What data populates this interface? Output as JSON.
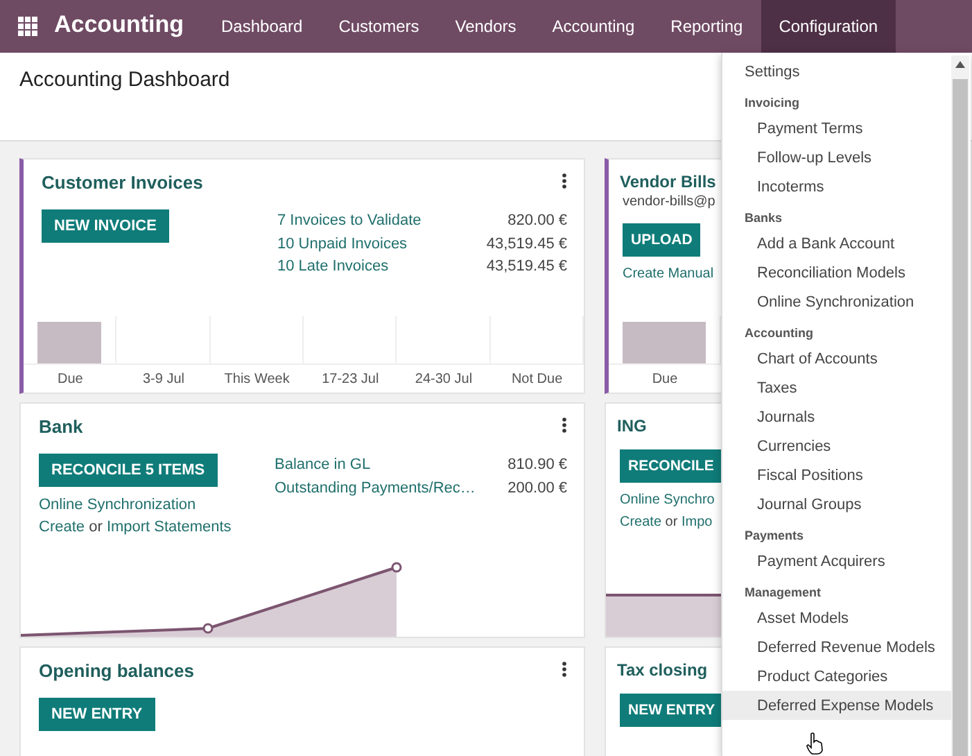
{
  "navbar": {
    "brand": "Accounting",
    "menus": [
      {
        "label": "Dashboard",
        "selected": false
      },
      {
        "label": "Customers",
        "selected": false
      },
      {
        "label": "Vendors",
        "selected": false
      },
      {
        "label": "Accounting",
        "selected": false
      },
      {
        "label": "Reporting",
        "selected": false
      },
      {
        "label": "Configuration",
        "selected": true
      }
    ]
  },
  "page_title": "Accounting Dashboard",
  "cards": [
    {
      "title": "Customer Invoices",
      "color": "#8a5ba6",
      "button": "NEW INVOICE",
      "stats": [
        {
          "label": "7 Invoices to Validate",
          "value": "820.00 €"
        },
        {
          "label": "10 Unpaid Invoices",
          "value": "43,519.45 €"
        },
        {
          "label": "10 Late Invoices",
          "value": "43,519.45 €"
        }
      ],
      "chart": {
        "kind": "bar",
        "labels": [
          "Due",
          "3-9 Jul",
          "This Week",
          "17-23 Jul",
          "24-30 Jul",
          "Not Due"
        ]
      }
    },
    {
      "title": "Vendor Bills",
      "color": "#8a5ba6",
      "subtitle": "vendor-bills@p",
      "button": "UPLOAD",
      "links": [
        [
          {
            "text": "Create Manual",
            "link": true
          }
        ]
      ],
      "chart": {
        "kind": "bar",
        "labels": [
          "Due"
        ]
      }
    },
    {
      "title": "Bank",
      "button": "RECONCILE 5 ITEMS",
      "links": [
        [
          {
            "text": "Online Synchronization",
            "link": true
          }
        ],
        [
          {
            "text": "Create",
            "link": true
          },
          {
            "text": "or",
            "link": false
          },
          {
            "text": "Import Statements",
            "link": true
          }
        ]
      ],
      "stats": [
        {
          "label": "Balance in GL",
          "value": "810.90 €"
        },
        {
          "label": "Outstanding Payments/Rec…",
          "value": "200.00 €"
        }
      ],
      "chart": {
        "kind": "line"
      }
    },
    {
      "title": "ING",
      "button": "RECONCILE",
      "links": [
        [
          {
            "text": "Online Synchro",
            "link": true
          }
        ],
        [
          {
            "text": "Create",
            "link": true
          },
          {
            "text": "or",
            "link": false
          },
          {
            "text": "Impo",
            "link": true
          }
        ]
      ],
      "chart": {
        "kind": "flat"
      }
    },
    {
      "title": "Opening balances",
      "button": "NEW ENTRY"
    },
    {
      "title": "Tax closing",
      "button": "NEW ENTRY"
    }
  ],
  "dropdown": [
    {
      "kind": "item",
      "label": "Settings",
      "selected": false
    },
    {
      "kind": "header",
      "label": "Invoicing"
    },
    {
      "kind": "subitem",
      "label": "Payment Terms",
      "selected": false
    },
    {
      "kind": "subitem",
      "label": "Follow-up Levels",
      "selected": false
    },
    {
      "kind": "subitem",
      "label": "Incoterms",
      "selected": false
    },
    {
      "kind": "header",
      "label": "Banks"
    },
    {
      "kind": "subitem",
      "label": "Add a Bank Account",
      "selected": false
    },
    {
      "kind": "subitem",
      "label": "Reconciliation Models",
      "selected": false
    },
    {
      "kind": "subitem",
      "label": "Online Synchronization",
      "selected": false
    },
    {
      "kind": "header",
      "label": "Accounting"
    },
    {
      "kind": "subitem",
      "label": "Chart of Accounts",
      "selected": false
    },
    {
      "kind": "subitem",
      "label": "Taxes",
      "selected": false
    },
    {
      "kind": "subitem",
      "label": "Journals",
      "selected": false
    },
    {
      "kind": "subitem",
      "label": "Currencies",
      "selected": false
    },
    {
      "kind": "subitem",
      "label": "Fiscal Positions",
      "selected": false
    },
    {
      "kind": "subitem",
      "label": "Journal Groups",
      "selected": false
    },
    {
      "kind": "header",
      "label": "Payments"
    },
    {
      "kind": "subitem",
      "label": "Payment Acquirers",
      "selected": false
    },
    {
      "kind": "header",
      "label": "Management"
    },
    {
      "kind": "subitem",
      "label": "Asset Models",
      "selected": false
    },
    {
      "kind": "subitem",
      "label": "Deferred Revenue Models",
      "selected": false
    },
    {
      "kind": "subitem",
      "label": "Product Categories",
      "selected": false
    },
    {
      "kind": "subitem",
      "label": "Deferred Expense Models",
      "selected": true
    }
  ]
}
